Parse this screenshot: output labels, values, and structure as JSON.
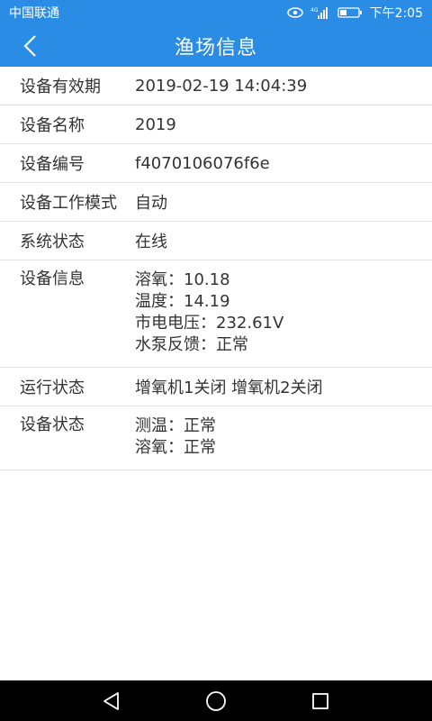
{
  "status_bar": {
    "carrier": "中国联通",
    "network": "4G",
    "time": "下午2:05"
  },
  "header": {
    "title": "渔场信息"
  },
  "rows": [
    {
      "label": "设备有效期",
      "value": "2019-02-19 14:04:39"
    },
    {
      "label": "设备名称",
      "value": "2019"
    },
    {
      "label": "设备编号",
      "value": "f4070106076f6e"
    },
    {
      "label": "设备工作模式",
      "value": "自动"
    },
    {
      "label": "系统状态",
      "value": "在线"
    }
  ],
  "device_info": {
    "label": "设备信息",
    "lines": [
      "溶氧：10.18",
      "温度：14.19",
      "市电电压：232.61V",
      "水泵反馈：正常"
    ]
  },
  "run_status": {
    "label": "运行状态",
    "value": "增氧机1关闭 增氧机2关闭"
  },
  "device_status": {
    "label": "设备状态",
    "lines": [
      "测温：正常",
      "溶氧：正常"
    ]
  },
  "colors": {
    "primary": "#2a8ce5",
    "divider": "#e2e2e2",
    "text": "#333333",
    "nav": "#000000"
  }
}
